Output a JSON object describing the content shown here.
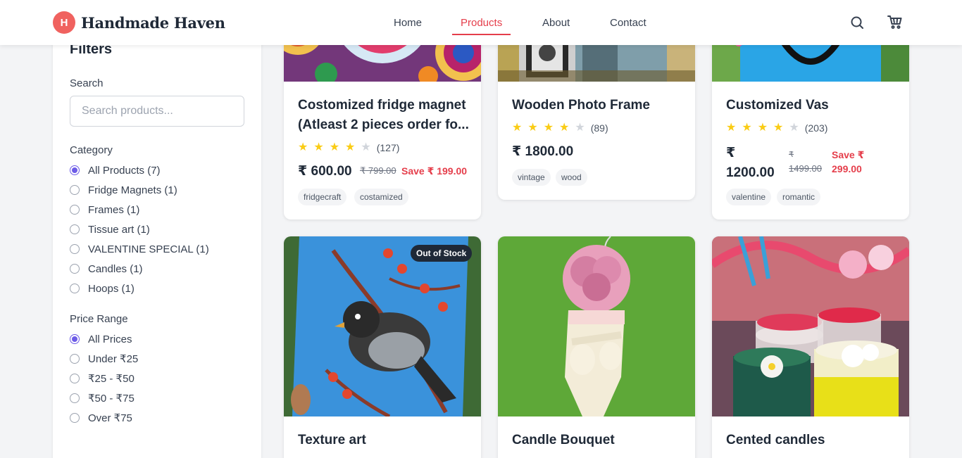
{
  "brand": {
    "initial": "H",
    "name": "Handmade Haven"
  },
  "nav": {
    "home": "Home",
    "products": "Products",
    "about": "About",
    "contact": "Contact"
  },
  "header_icons": {
    "search": "search-icon",
    "cart": "cart-icon"
  },
  "colors": {
    "accent": "#e53e4b",
    "logo": "#f0625f",
    "radio_checked": "#6d5ce7",
    "star": "#facc15"
  },
  "filters": {
    "title": "Filters",
    "search_label": "Search",
    "search_placeholder": "Search products...",
    "category_label": "Category",
    "categories": [
      {
        "label": "All Products (7)",
        "checked": true
      },
      {
        "label": "Fridge Magnets (1)",
        "checked": false
      },
      {
        "label": "Frames (1)",
        "checked": false
      },
      {
        "label": "Tissue art (1)",
        "checked": false
      },
      {
        "label": "VALENTINE SPECIAL (1)",
        "checked": false
      },
      {
        "label": "Candles (1)",
        "checked": false
      },
      {
        "label": "Hoops (1)",
        "checked": false
      }
    ],
    "price_label": "Price Range",
    "prices": [
      {
        "label": "All Prices",
        "checked": true
      },
      {
        "label": "Under ₹25",
        "checked": false
      },
      {
        "label": "₹25 - ₹50",
        "checked": false
      },
      {
        "label": "₹50 - ₹75",
        "checked": false
      },
      {
        "label": "Over ₹75",
        "checked": false
      }
    ]
  },
  "products": [
    {
      "title": "Costomized fridge magnet (Atleast 2 pieces order fo...",
      "rating": 4,
      "reviews": "(127)",
      "price": "₹ 600.00",
      "old_price": "₹ 799.00",
      "save": "Save ₹ 199.00",
      "tags": [
        "fridgecraft",
        "costamized"
      ]
    },
    {
      "title": "Wooden Photo Frame",
      "rating": 4,
      "reviews": "(89)",
      "price": "₹ 1800.00",
      "tags": [
        "vintage",
        "wood"
      ]
    },
    {
      "title": "Customized Vas",
      "rating": 4,
      "reviews": "(203)",
      "price_line1": "₹",
      "price_line2": "1200.00",
      "old_price_line1": "₹",
      "old_price_line2": "1499.00",
      "save_line1": "Save ₹",
      "save_line2": "299.00",
      "tags": [
        "valentine",
        "romantic"
      ]
    },
    {
      "title": "Texture art",
      "badge": "Out of Stock"
    },
    {
      "title": "Candle Bouquet"
    },
    {
      "title": "Cented candles"
    }
  ]
}
